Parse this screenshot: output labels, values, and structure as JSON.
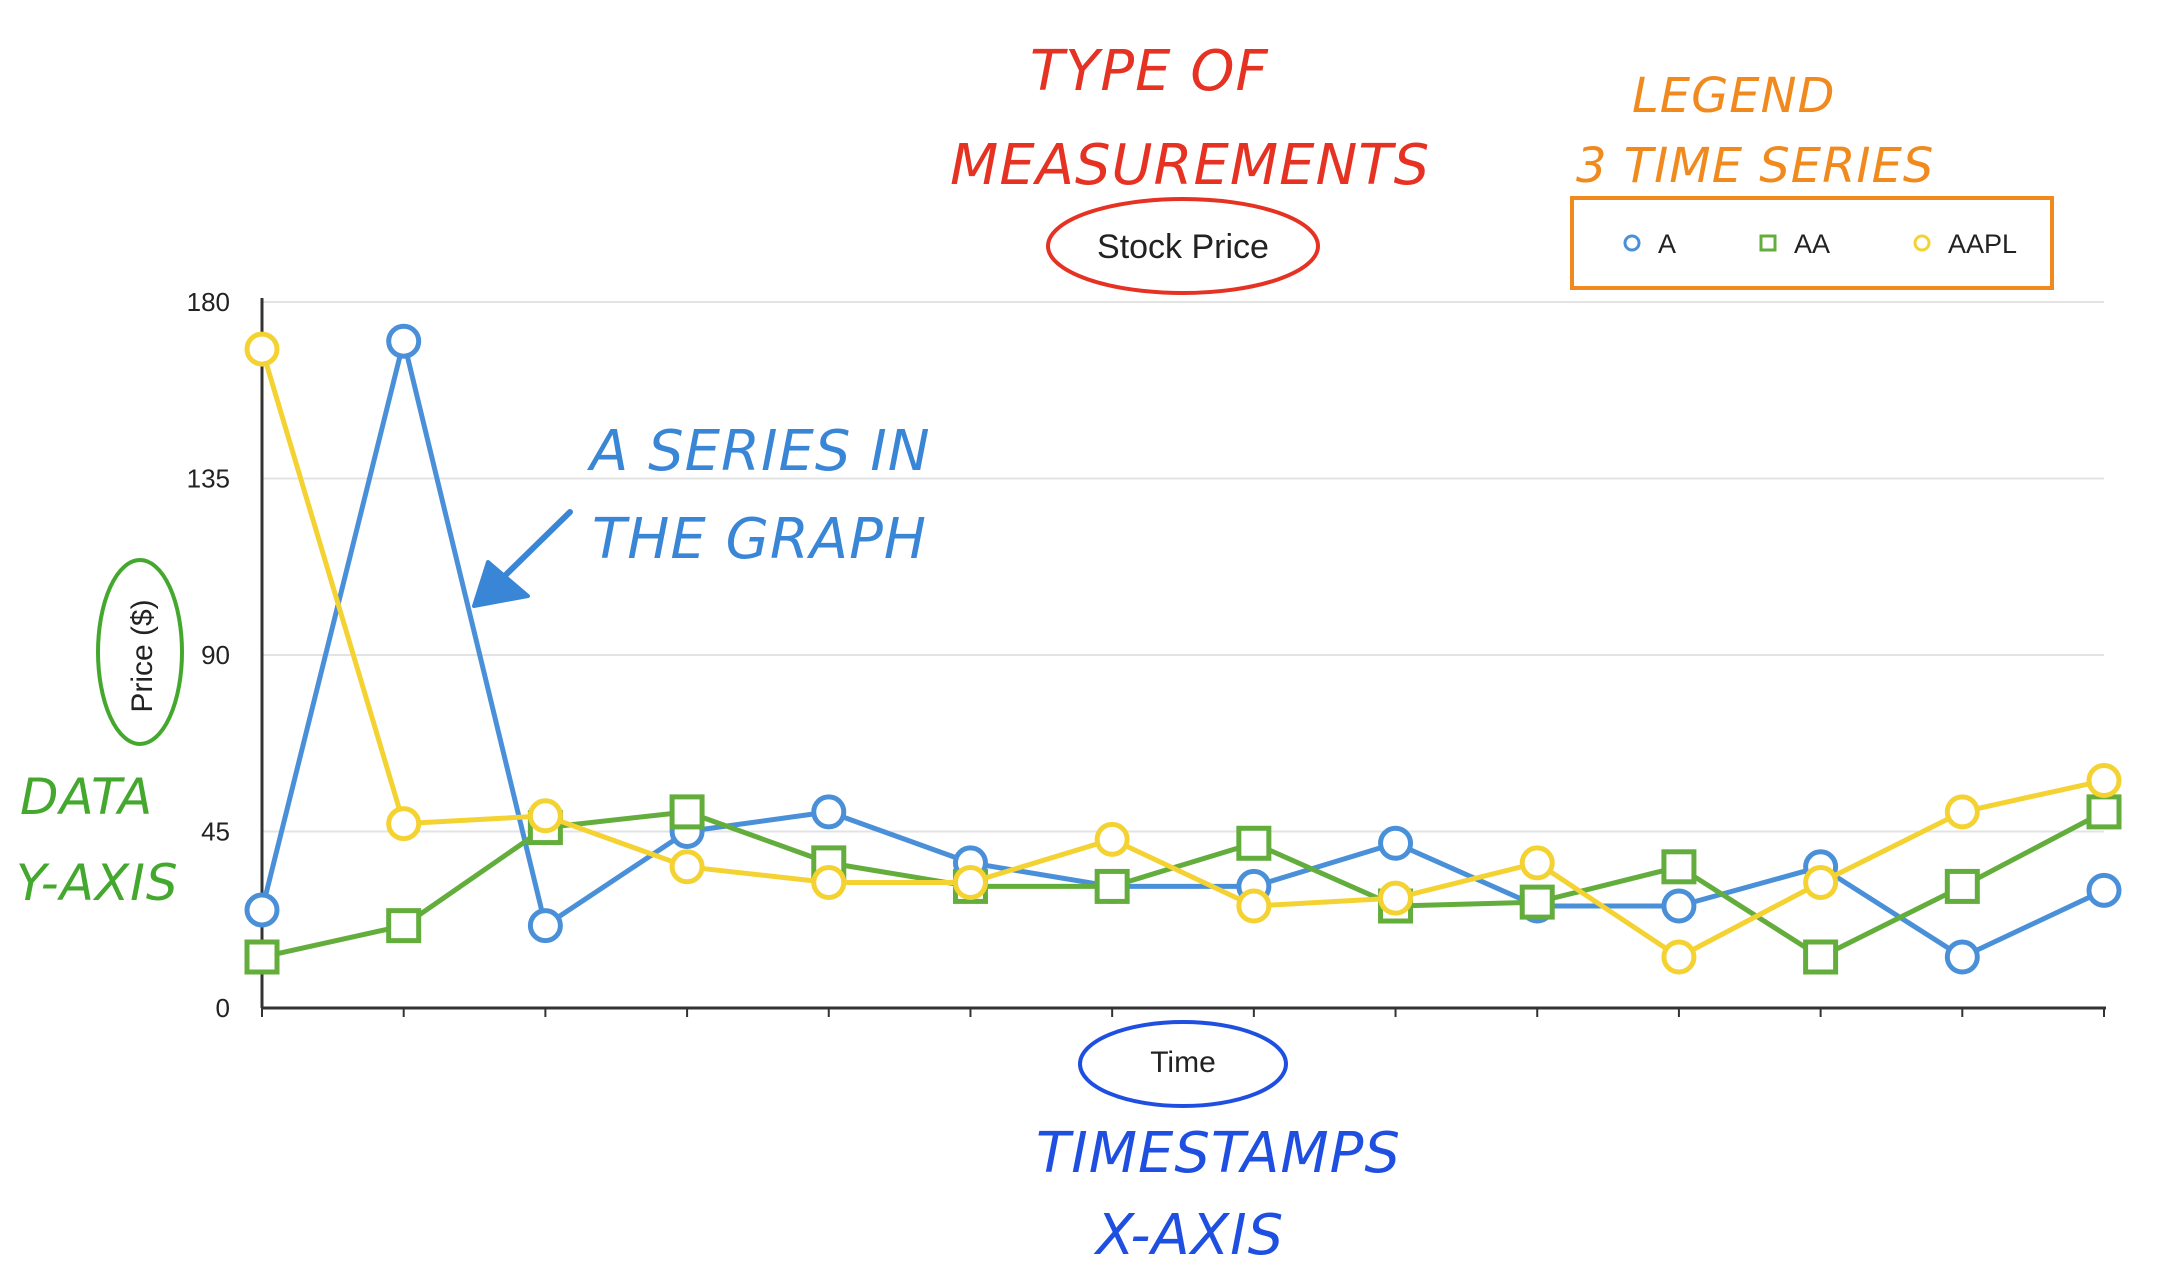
{
  "chart_data": {
    "type": "line",
    "title": "Stock Price",
    "xlabel": "Time",
    "ylabel": "Price ($)",
    "ylim": [
      0,
      180
    ],
    "yticks": [
      "0",
      "45",
      "90",
      "135",
      "180"
    ],
    "x": [
      1,
      2,
      3,
      4,
      5,
      6,
      7,
      8,
      9,
      10,
      11,
      12,
      13,
      14
    ],
    "grid": true,
    "legend_position": "top-right",
    "series": [
      {
        "name": "A",
        "color": "#4a90d9",
        "marker": "circle",
        "values": [
          25,
          170,
          21,
          45,
          50,
          37,
          31,
          31,
          42,
          26,
          26,
          36,
          13,
          30
        ]
      },
      {
        "name": "AA",
        "color": "#63ad3c",
        "marker": "square",
        "values": [
          13,
          21,
          46,
          50,
          37,
          31,
          31,
          42,
          26,
          27,
          36,
          13,
          31,
          50
        ]
      },
      {
        "name": "AAPL",
        "color": "#f4d232",
        "marker": "circle",
        "values": [
          168,
          47,
          49,
          36,
          32,
          32,
          43,
          26,
          28,
          37,
          13,
          32,
          50,
          58
        ]
      }
    ]
  },
  "annotations": {
    "type_of_measurements": {
      "lines": [
        "TYPE OF",
        "MEASUREMENTS"
      ],
      "color": "#e53223"
    },
    "legend_note": {
      "lines": [
        "LEGEND",
        "3 TIME SERIES"
      ],
      "color": "#f08a1f"
    },
    "series_note": {
      "lines": [
        "A SERIES IN",
        "THE GRAPH"
      ],
      "color": "#3a86d6"
    },
    "y_axis_note": {
      "lines": [
        "DATA",
        "Y-AXIS"
      ],
      "color": "#44a82e"
    },
    "x_axis_note": {
      "lines": [
        "TIMESTAMPS",
        "X-AXIS"
      ],
      "color": "#1f4fe0"
    }
  }
}
